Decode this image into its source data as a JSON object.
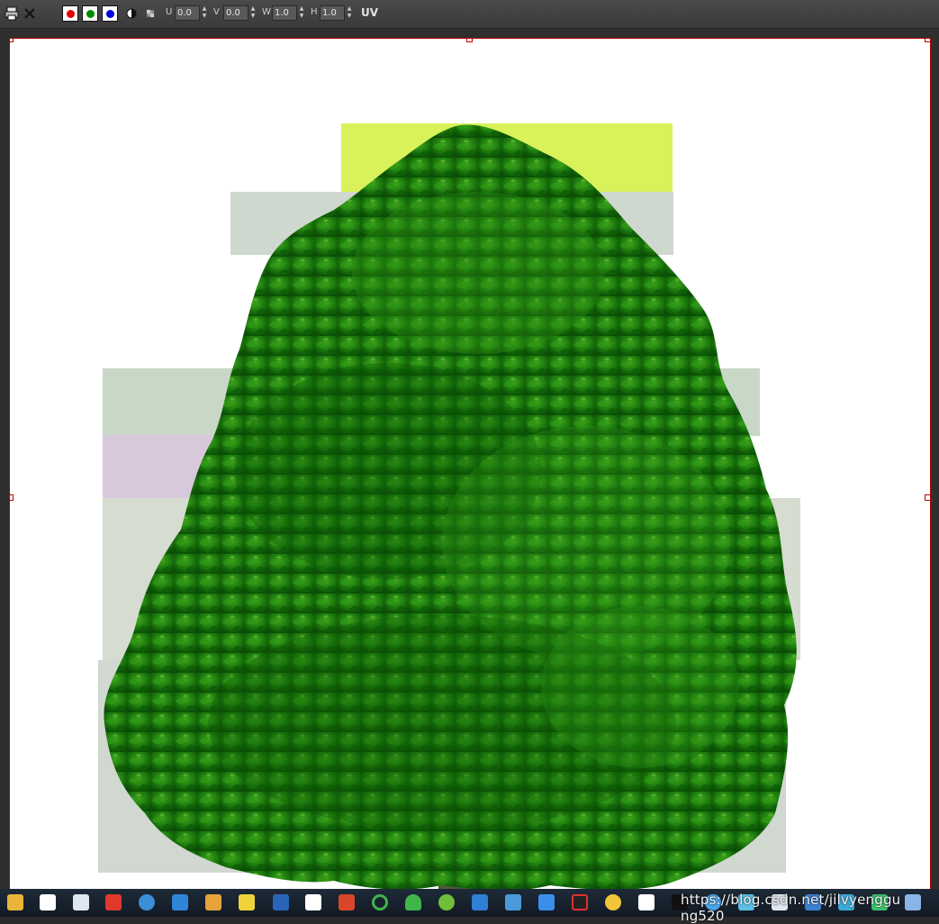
{
  "toolbar": {
    "u_label": "U",
    "u_value": "0.0",
    "v_label": "V",
    "v_value": "0.0",
    "w_label": "W",
    "w_value": "1.0",
    "h_label": "H",
    "h_value": "1.0",
    "uv_label": "UV",
    "swatches": [
      {
        "name": "red-channel",
        "color": "#e00000"
      },
      {
        "name": "green-channel",
        "color": "#008a00"
      },
      {
        "name": "blue-channel",
        "color": "#0000e0"
      }
    ],
    "icons": [
      "print-icon",
      "close-icon",
      "contrast-icon",
      "checker-icon"
    ]
  },
  "canvas": {
    "border_color": "#b30000",
    "image_subject": "tree-image"
  },
  "taskbar": {
    "apps": [
      "file-explorer-icon",
      "text-editor-icon",
      "window-icon",
      "xmind-icon",
      "browser-icon",
      "notes-icon",
      "photos-icon",
      "qq-icon",
      "revit-icon",
      "wps-icon",
      "wps-writer-icon",
      "loader-icon",
      "cloud-icon",
      "game-icon",
      "table-icon",
      "mail-icon",
      "feishu-icon",
      "record-icon",
      "star-icon",
      "baidu-icon",
      "tiktok-icon"
    ]
  },
  "watermark": "https://blog.csdn.net/jilvyenggu ng520"
}
